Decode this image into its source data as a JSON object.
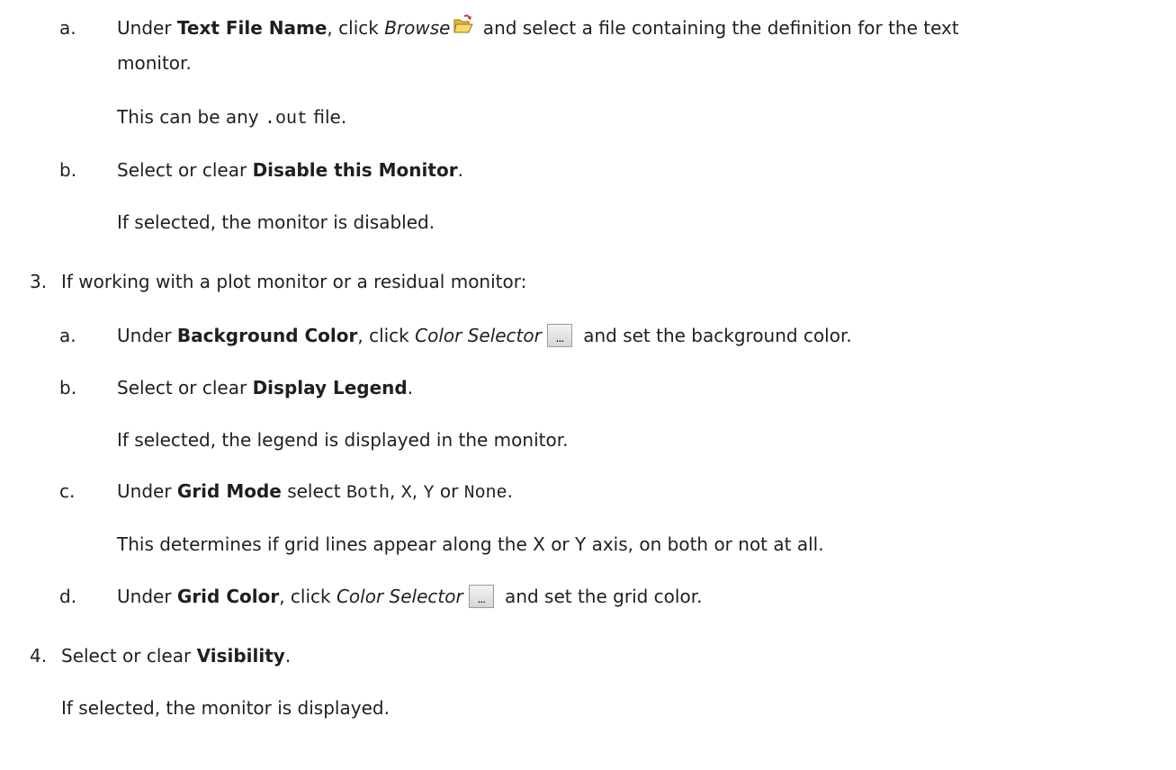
{
  "doc": {
    "step_a1": {
      "marker": "a.",
      "pre": "Under ",
      "bold": "Text File Name",
      "mid": ", click ",
      "ital": "Browse",
      "post": " and select a file containing the definition for the text",
      "cont": "monitor.",
      "icon": "folder-open-icon"
    },
    "note_a1": {
      "pre": "This can be any ",
      "code": ".out",
      "post": " file."
    },
    "step_b1": {
      "marker": "b.",
      "pre": "Select or clear ",
      "bold": "Disable this Monitor",
      "post": "."
    },
    "note_b1": "If selected, the monitor is disabled.",
    "step_3": {
      "marker": "3.",
      "text": "If working with a plot monitor or a residual monitor:"
    },
    "step_a2": {
      "marker": "a.",
      "pre": "Under ",
      "bold": "Background Color",
      "mid": ", click ",
      "ital": "Color Selector",
      "post": " and set the background color.",
      "icon": "ellipsis-button-icon"
    },
    "step_b2": {
      "marker": "b.",
      "pre": "Select or clear ",
      "bold": "Display Legend",
      "post": "."
    },
    "note_b2": "If selected, the legend is displayed in the monitor.",
    "step_c2": {
      "marker": "c.",
      "pre": "Under ",
      "bold": "Grid Mode",
      "mid": " select ",
      "code1": "Both",
      "sep1": ", ",
      "code2": "X",
      "sep2": ", ",
      "code3": "Y",
      "sep3": " or ",
      "code4": "None",
      "post": "."
    },
    "note_c2": "This determines if grid lines appear along the X or Y axis, on both or not at all.",
    "step_d2": {
      "marker": "d.",
      "pre": "Under ",
      "bold": "Grid Color",
      "mid": ", click ",
      "ital": "Color Selector",
      "post": " and set the grid color.",
      "icon": "ellipsis-button-icon"
    },
    "step_4": {
      "marker": "4.",
      "pre": "Select or clear ",
      "bold": "Visibility",
      "post": "."
    },
    "note_4": "If selected, the monitor is displayed.",
    "ellipsis_label": "..."
  }
}
